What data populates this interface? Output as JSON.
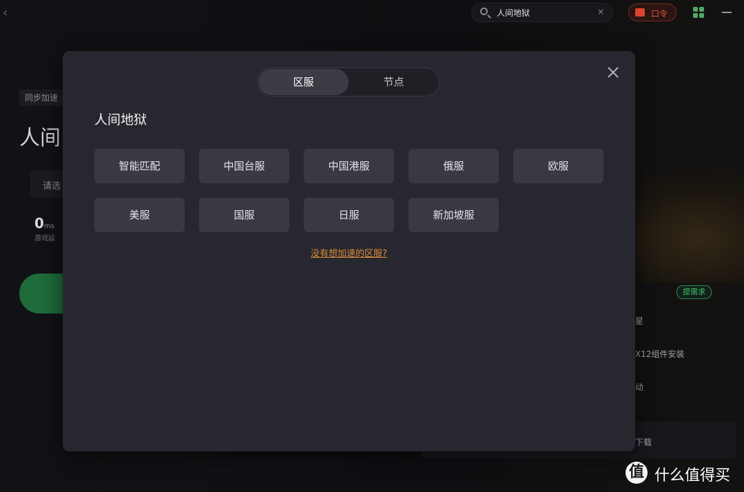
{
  "topbar": {
    "search_value": "人间地狱",
    "clear_symbol": "×",
    "code_button_label": "口令"
  },
  "background": {
    "tag": "同步加速",
    "title": "人间",
    "select_placeholder": "请选",
    "ping_value": "0",
    "ping_unit": "ms",
    "ping_sub": "游戏延",
    "request_badge": "提需求",
    "side_texts": [
      "星",
      "X12组件安装",
      "动",
      "下载"
    ]
  },
  "modal": {
    "tabs": [
      {
        "label": "区服",
        "active": true
      },
      {
        "label": "节点",
        "active": false
      }
    ],
    "game_title": "人间地狱",
    "regions": [
      "智能匹配",
      "中国台服",
      "中国港服",
      "俄服",
      "欧服",
      "美服",
      "国服",
      "日服",
      "新加坡服"
    ],
    "missing_region_link": "没有想加速的区服?"
  },
  "watermark": {
    "logo_char": "值",
    "text": "什么值得买"
  },
  "colors": {
    "modal_bg": "#27282f",
    "region_button_bg": "#383942",
    "link_orange": "#d98a3a",
    "accent_green": "#44c56a",
    "accent_red": "#e3563d"
  }
}
